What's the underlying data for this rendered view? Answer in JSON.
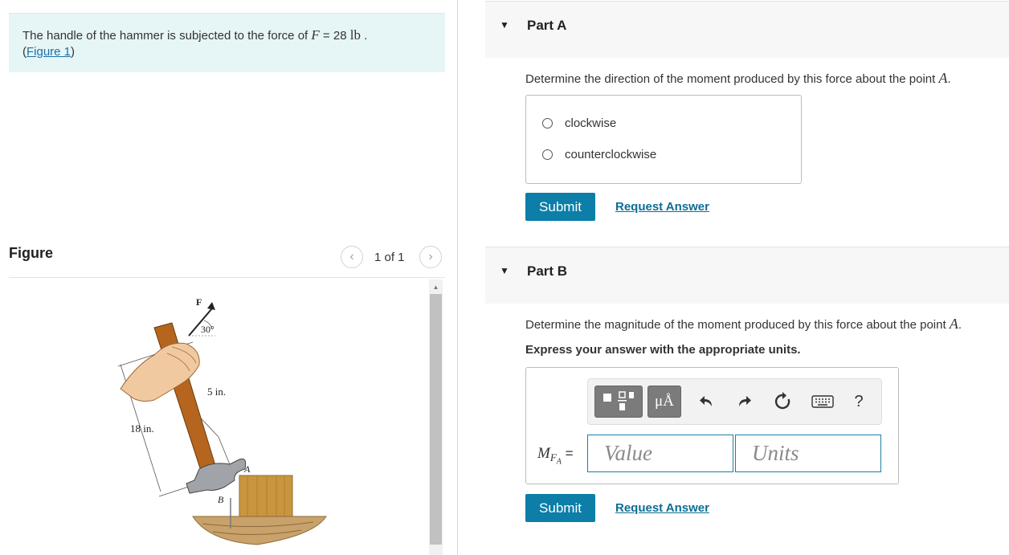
{
  "problem": {
    "text_prefix": "The handle of the hammer is subjected to the force of ",
    "force_var": "F",
    "force_eq": " = 28 ",
    "force_unit": "lb",
    "period": " .",
    "link_open": "(",
    "link_text": "Figure 1",
    "link_close": ")"
  },
  "figure": {
    "heading": "Figure",
    "counter": "1 of 1",
    "prev_icon": "chevron-left",
    "next_icon": "chevron-right",
    "labels": {
      "force": "F",
      "angle": "30°",
      "dist1": "5 in.",
      "dist2": "18 in.",
      "point_a": "A",
      "point_b": "B"
    }
  },
  "part_a": {
    "title": "Part A",
    "question_prefix": "Determine the direction of the moment produced by this force about the point ",
    "question_var": "A",
    "question_end": ".",
    "options": [
      "clockwise",
      "counterclockwise"
    ],
    "submit": "Submit",
    "request": "Request Answer"
  },
  "part_b": {
    "title": "Part B",
    "question_prefix": "Determine the magnitude of the moment produced by this force about the point ",
    "question_var": "A",
    "question_end": ".",
    "instruction": "Express your answer with the appropriate units.",
    "label_main": "M",
    "label_sub": "F",
    "label_subsub": "A",
    "label_eq": " =",
    "value_placeholder": "Value",
    "units_placeholder": "Units",
    "units_symbol": "μÅ",
    "help": "?",
    "submit": "Submit",
    "request": "Request Answer"
  },
  "colors": {
    "accent": "#0c7ea8",
    "problem_bg": "#e6f5f6",
    "link": "#1a6fa8"
  }
}
